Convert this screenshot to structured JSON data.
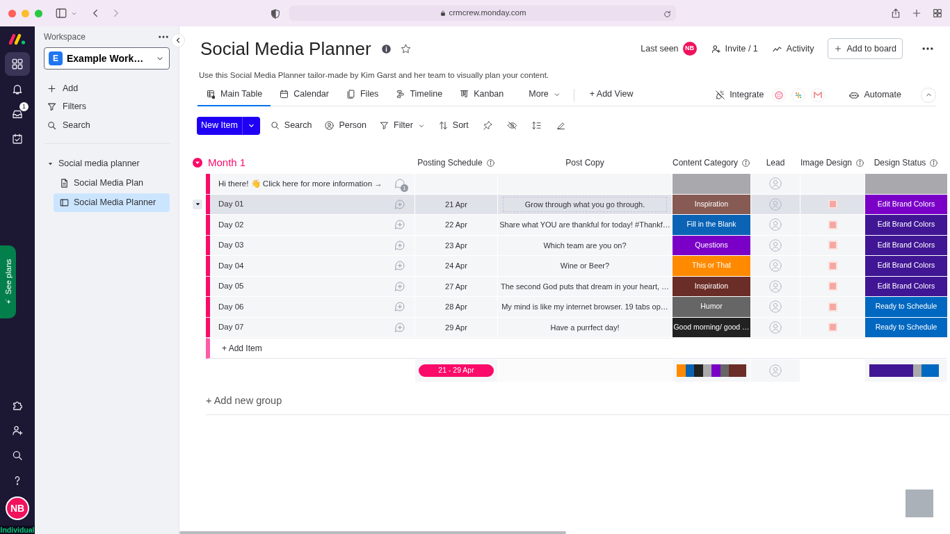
{
  "browser": {
    "url": "crmcrew.monday.com"
  },
  "rail": {
    "inbox_count": "1",
    "see_plans": "See plans",
    "avatar": "NB",
    "plan": "Individual"
  },
  "workspace": {
    "label": "Workspace",
    "badge": "E",
    "name": "Example Work…",
    "actions": [
      "Add",
      "Filters",
      "Search"
    ],
    "tree": [
      {
        "label": "Social media planner",
        "expanded": true,
        "children": [
          {
            "kind": "doc",
            "label": "Social Media Plan",
            "selected": false
          },
          {
            "kind": "board",
            "label": "Social Media Planner",
            "selected": true
          }
        ]
      }
    ]
  },
  "board": {
    "title": "Social Media Planner",
    "description": "Use this Social Media Planner tailor-made by Kim Garst and her team to visually plan your content.",
    "last_seen": "Last seen",
    "last_seen_avatar": "NB",
    "invite": "Invite / 1",
    "activity": "Activity",
    "add_to_board": "Add to board"
  },
  "tabs": [
    {
      "label": "Main Table",
      "selected": true
    },
    {
      "label": "Calendar",
      "selected": false
    },
    {
      "label": "Files",
      "selected": false
    },
    {
      "label": "Timeline",
      "selected": false
    },
    {
      "label": "Kanban",
      "selected": false
    },
    {
      "label": "More",
      "selected": false
    }
  ],
  "add_view": "+ Add View",
  "integrate": "Integrate",
  "automate": "Automate",
  "toolbar": {
    "new_item": "New Item",
    "tools": [
      "Search",
      "Person",
      "Filter",
      "Sort"
    ]
  },
  "group": {
    "title": "Month 1",
    "expanded": true
  },
  "columns": [
    {
      "label": "Posting Schedule",
      "info": true
    },
    {
      "label": "Post Copy"
    },
    {
      "label": "Content Category",
      "info": true
    },
    {
      "label": "Lead"
    },
    {
      "label": "Image Design",
      "info": true
    },
    {
      "label": "Design Status",
      "info": true
    }
  ],
  "rows": [
    {
      "name": "Hi there! 👋 Click here for more information →",
      "updates": "1",
      "selected": false,
      "category": {
        "color": "#a9a9ad"
      },
      "image": false,
      "status": {
        "color": "#a9a9ad"
      }
    },
    {
      "name": "Day 01",
      "selected": true,
      "editing": true,
      "date": "21 Apr",
      "copy": "Grow through what you go through.",
      "category": {
        "label": "Inspiration",
        "color": "#875a53"
      },
      "image": true,
      "status": {
        "label": "Edit Brand Colors",
        "color": "#7b00c7"
      }
    },
    {
      "name": "Day 02",
      "selected": false,
      "editing": false,
      "date": "22 Apr",
      "copy": "Share what YOU are thankful for today! #Thankf…",
      "category": {
        "label": "Fill in the Blank",
        "color": "#0a63b5"
      },
      "image": true,
      "status": {
        "label": "Edit Brand Colors",
        "color": "#401694"
      }
    },
    {
      "name": "Day 03",
      "selected": false,
      "editing": false,
      "date": "23 Apr",
      "copy": "Which team are you on?",
      "category": {
        "label": "Questions",
        "color": "#7b00c7"
      },
      "image": true,
      "status": {
        "label": "Edit Brand Colors",
        "color": "#401694"
      }
    },
    {
      "name": "Day 04",
      "selected": false,
      "editing": false,
      "date": "24 Apr",
      "copy": "Wine or Beer?",
      "category": {
        "label": "This or That",
        "color": "#ff8a00"
      },
      "image": true,
      "status": {
        "label": "Edit Brand Colors",
        "color": "#401694"
      }
    },
    {
      "name": "Day 05",
      "selected": false,
      "editing": false,
      "date": "27 Apr",
      "copy": "The second God puts that dream in your heart, …",
      "category": {
        "label": "Inspiration",
        "color": "#6b2d27"
      },
      "image": true,
      "status": {
        "label": "Edit Brand Colors",
        "color": "#401694"
      }
    },
    {
      "name": "Day 06",
      "selected": false,
      "editing": false,
      "date": "28 Apr",
      "copy": "My mind is like my internet browser. 19 tabs op…",
      "category": {
        "label": "Humor",
        "color": "#666666"
      },
      "image": true,
      "status": {
        "label": "Ready to Schedule",
        "color": "#0068c0"
      }
    },
    {
      "name": "Day 07",
      "selected": false,
      "editing": false,
      "date": "29 Apr",
      "copy": "Have a purrfect day!",
      "category": {
        "label": "Good morning/ good …",
        "color": "#222222"
      },
      "image": true,
      "status": {
        "label": "Ready to Schedule",
        "color": "#0068c0"
      }
    }
  ],
  "add_item": "+ Add Item",
  "summary": {
    "date_range": "21 - 29 Apr",
    "category_segments": [
      {
        "color": "#ff8a00"
      },
      {
        "color": "#0a63b5"
      },
      {
        "color": "#222222"
      },
      {
        "color": "#aaaaaa"
      },
      {
        "color": "#7b00c7"
      },
      {
        "color": "#666666"
      },
      {
        "color": "#6b2d27"
      },
      {
        "color": "#6b2d27"
      }
    ],
    "status_segments": [
      {
        "color": "#401694"
      },
      {
        "color": "#401694"
      },
      {
        "color": "#401694"
      },
      {
        "color": "#401694"
      },
      {
        "color": "#401694"
      },
      {
        "color": "#aaaaaa"
      },
      {
        "color": "#0068c0"
      },
      {
        "color": "#0068c0"
      }
    ]
  },
  "add_group": "+ Add new group"
}
